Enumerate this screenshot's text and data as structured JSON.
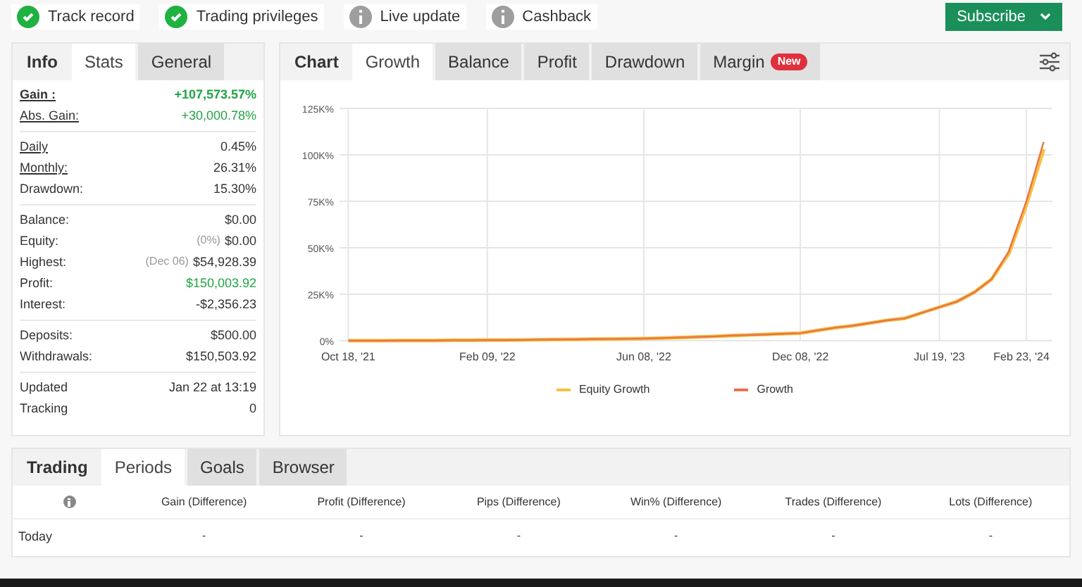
{
  "badges": [
    {
      "label": "Track record",
      "kind": "check"
    },
    {
      "label": "Trading privileges",
      "kind": "check"
    },
    {
      "label": "Live update",
      "kind": "info"
    },
    {
      "label": "Cashback",
      "kind": "info"
    }
  ],
  "subscribe": {
    "label": "Subscribe"
  },
  "stats_panel": {
    "heading": "Info",
    "tabs": [
      {
        "label": "Stats",
        "selected": true
      },
      {
        "label": "General",
        "selected": false
      }
    ],
    "sections": [
      [
        {
          "label": "Gain :",
          "value": "+107,573.57%",
          "underlined": true,
          "bold": true,
          "color": "#22a447"
        },
        {
          "label": "Abs. Gain:",
          "value": "+30,000.78%",
          "underlined": true,
          "bold": false,
          "color": "#22a447"
        }
      ],
      [
        {
          "label": "Daily",
          "value": "0.45%",
          "underlined": true,
          "bold": false
        },
        {
          "label": "Monthly:",
          "value": "26.31%",
          "underlined": true,
          "bold": false
        },
        {
          "label": "Drawdown:",
          "value": "15.30%",
          "underlined": false,
          "bold": false
        }
      ],
      [
        {
          "label": "Balance:",
          "value": "$0.00",
          "underlined": false,
          "bold": false
        },
        {
          "label": "Equity:",
          "note": "(0%)",
          "value": "$0.00",
          "underlined": false,
          "bold": false
        },
        {
          "label": "Highest:",
          "note": "(Dec 06)",
          "value": "$54,928.39",
          "underlined": false,
          "bold": false
        },
        {
          "label": "Profit:",
          "value": "$150,003.92",
          "underlined": false,
          "bold": false,
          "color": "#22a447"
        },
        {
          "label": "Interest:",
          "value": "-$2,356.23",
          "underlined": false,
          "bold": false
        }
      ],
      [
        {
          "label": "Deposits:",
          "value": "$500.00",
          "underlined": false,
          "bold": false
        },
        {
          "label": "Withdrawals:",
          "value": "$150,503.92",
          "underlined": false,
          "bold": false
        }
      ],
      [
        {
          "label": "Updated",
          "value": "Jan 22 at 13:19",
          "underlined": false,
          "bold": false
        },
        {
          "label": "Tracking",
          "value": "0",
          "underlined": false,
          "bold": false
        }
      ]
    ]
  },
  "chart_panel": {
    "heading": "Chart",
    "tabs": [
      {
        "label": "Growth",
        "selected": true
      },
      {
        "label": "Balance",
        "selected": false
      },
      {
        "label": "Profit",
        "selected": false
      },
      {
        "label": "Drawdown",
        "selected": false
      },
      {
        "label": "Margin",
        "selected": false,
        "badge": "New"
      }
    ],
    "chart_data": {
      "type": "line",
      "categories": [
        "Oct 18, '21",
        null,
        null,
        null,
        null,
        null,
        null,
        null,
        "Feb 09, '22",
        null,
        null,
        null,
        null,
        null,
        null,
        null,
        null,
        "Jun 08, '22",
        null,
        null,
        null,
        null,
        null,
        null,
        null,
        null,
        "Dec 08, '22",
        null,
        null,
        null,
        null,
        null,
        null,
        null,
        "Jul 19, '23",
        null,
        null,
        null,
        null,
        "Feb 23, '24",
        null
      ],
      "series": [
        {
          "name": "Equity Growth",
          "color": "#f5c242",
          "values": [
            0,
            0,
            0,
            0.1,
            0.1,
            0.1,
            0.2,
            0.2,
            0.3,
            0.3,
            0.4,
            0.5,
            0.6,
            0.7,
            0.8,
            0.9,
            1,
            1.1,
            1.4,
            1.7,
            2,
            2.3,
            2.7,
            3,
            3.3,
            3.7,
            4,
            5.5,
            7,
            8,
            9.5,
            11,
            12,
            15,
            18,
            21,
            26,
            33,
            47,
            73,
            103
          ]
        },
        {
          "name": "Growth",
          "color": "#e8734a",
          "values": [
            0,
            0,
            0,
            0.1,
            0.1,
            0.1,
            0.2,
            0.2,
            0.3,
            0.3,
            0.4,
            0.5,
            0.6,
            0.7,
            0.8,
            0.9,
            1,
            1.1,
            1.4,
            1.7,
            2,
            2.3,
            2.7,
            3,
            3.3,
            3.7,
            4,
            5.5,
            7,
            8,
            9.5,
            11,
            12,
            15,
            18,
            21,
            26,
            33,
            48,
            75,
            107
          ]
        }
      ],
      "ylim": [
        0,
        125
      ],
      "grid": true,
      "legend": "bottom",
      "yticks": [
        {
          "value": 0,
          "label": "0%"
        },
        {
          "value": 25,
          "label": "25K%"
        },
        {
          "value": 50,
          "label": "50K%"
        },
        {
          "value": 75,
          "label": "75K%"
        },
        {
          "value": 100,
          "label": "100K%"
        },
        {
          "value": 125,
          "label": "125K%"
        }
      ]
    }
  },
  "periods_panel": {
    "heading": "Trading",
    "tabs": [
      {
        "label": "Periods",
        "selected": true
      },
      {
        "label": "Goals",
        "selected": false
      },
      {
        "label": "Browser",
        "selected": false
      }
    ],
    "columns": [
      "Gain (Difference)",
      "Profit (Difference)",
      "Pips (Difference)",
      "Win% (Difference)",
      "Trades (Difference)",
      "Lots (Difference)"
    ],
    "rows": [
      {
        "label": "Today",
        "cells": [
          "-",
          "-",
          "-",
          "-",
          "-",
          "-"
        ]
      }
    ]
  }
}
